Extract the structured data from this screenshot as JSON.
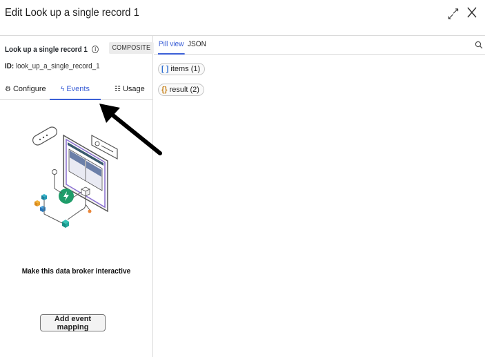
{
  "header": {
    "title": "Edit Look up a single record 1"
  },
  "left_panel": {
    "record_title": "Look up a single record 1",
    "badge": "COMPOSITE",
    "id_label": "ID:",
    "id_value": "look_up_a_single_record_1",
    "tabs": [
      {
        "label": "Configure",
        "icon": "gear-icon"
      },
      {
        "label": "Events",
        "icon": "lightning-icon",
        "active": true
      },
      {
        "label": "Usage",
        "icon": "list-icon"
      }
    ],
    "empty_state": {
      "heading": "Make this data broker interactive",
      "button_label": "Add event mapping"
    }
  },
  "right_panel": {
    "tabs": [
      {
        "label": "Pill view",
        "active": true
      },
      {
        "label": "JSON"
      }
    ],
    "pills": [
      {
        "label": "items (1)",
        "type_symbol": "[ ]"
      },
      {
        "label": "result (2)",
        "type_symbol": "{}"
      }
    ]
  },
  "colors": {
    "accent": "#3b5fd6",
    "border": "#d9d9d9",
    "illustration_green": "#1f9d6a",
    "illustration_purple": "#8a6fd1"
  }
}
